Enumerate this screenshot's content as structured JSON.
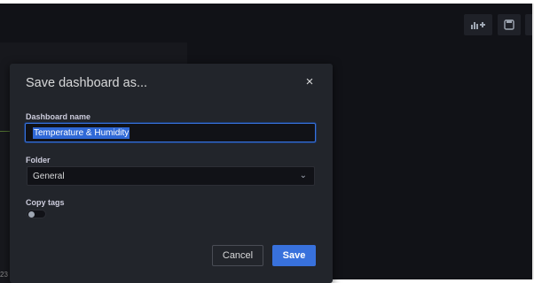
{
  "toolbar": {
    "add_panel_icon": "add-panel-icon",
    "save_icon": "save-icon",
    "settings_icon": "settings-icon"
  },
  "background": {
    "axis_label": "23"
  },
  "modal": {
    "title": "Save dashboard as...",
    "close_icon": "×",
    "dashboard_name": {
      "label": "Dashboard name",
      "value": "Temperature & Humidity"
    },
    "folder": {
      "label": "Folder",
      "selected": "General",
      "chevron": "⌄"
    },
    "copy_tags": {
      "label": "Copy tags",
      "enabled": false
    },
    "buttons": {
      "cancel": "Cancel",
      "save": "Save"
    }
  },
  "colors": {
    "primary": "#3871dc",
    "modal_bg": "#22252b",
    "app_bg": "#111217"
  }
}
